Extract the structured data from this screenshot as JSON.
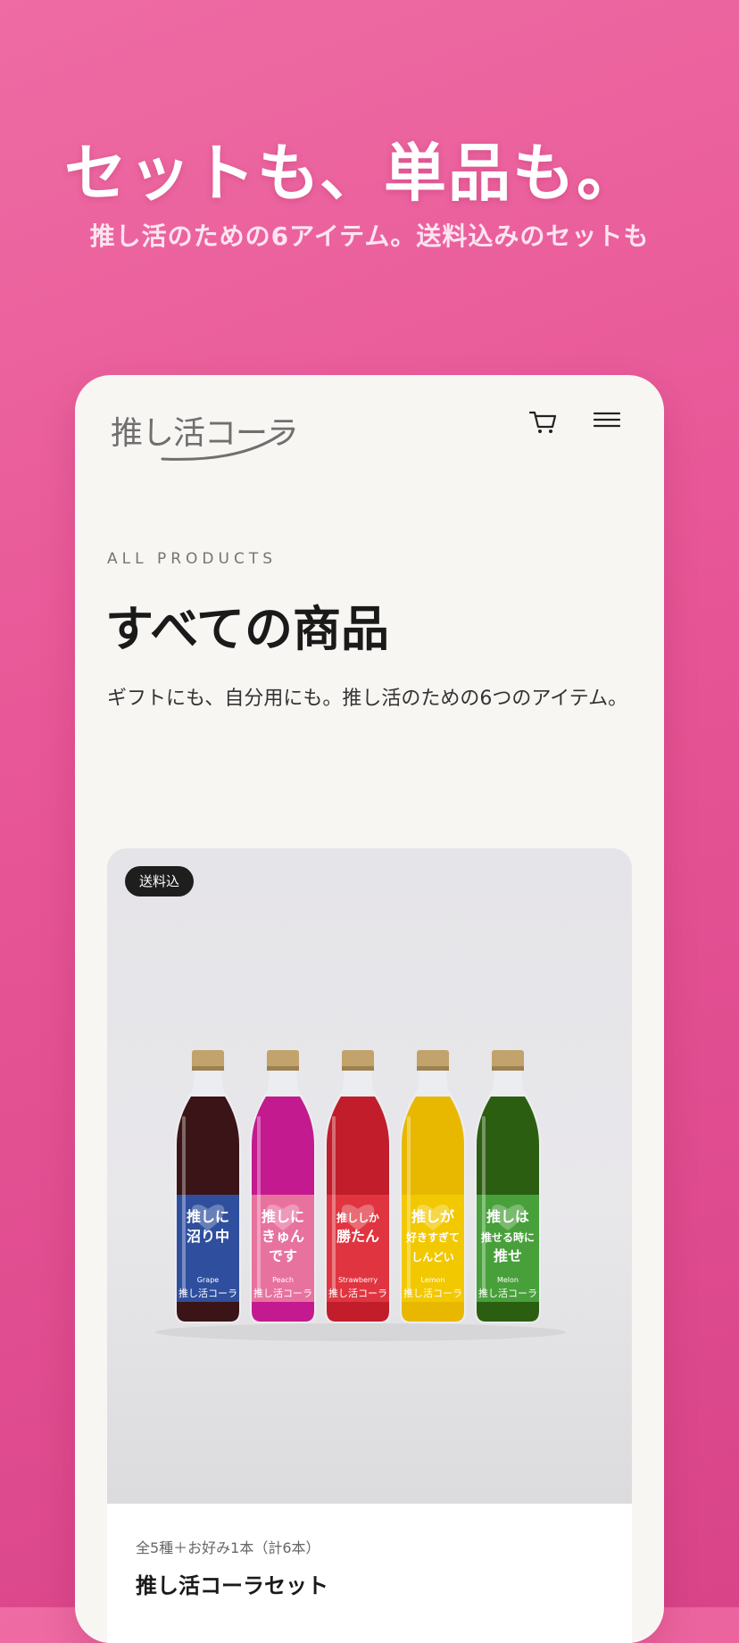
{
  "promo": {
    "headline": "セットも、単品も。",
    "subline": "推し活のための6アイテム。送料込みのセットも"
  },
  "header": {
    "logo_text": "推し活コーラ",
    "cart_icon": "cart-icon",
    "menu_icon": "menu-icon"
  },
  "page": {
    "eyebrow": "ALL PRODUCTS",
    "title": "すべての商品",
    "description": "ギフトにも、自分用にも。推し活のための6つのアイテム。"
  },
  "product": {
    "badge": "送料込",
    "subtitle": "全5種＋お好み1本（計6本）",
    "name": "推し活コーラセット",
    "bottles": [
      {
        "label_lines": [
          "推しに",
          "沼り中"
        ],
        "flavor": "Grape",
        "liquid": "#3a1416",
        "label_color": "#2f4f9e"
      },
      {
        "label_lines": [
          "推しに",
          "きゅん",
          "です"
        ],
        "flavor": "Peach",
        "liquid": "#c41a8f",
        "label_color": "#e8729e"
      },
      {
        "label_lines": [
          "推ししか",
          "勝たん"
        ],
        "flavor": "Strawberry",
        "liquid": "#c11d2b",
        "label_color": "#e03540"
      },
      {
        "label_lines": [
          "推しが",
          "好きすぎて",
          "しんどい"
        ],
        "flavor": "Lemon",
        "liquid": "#e8b800",
        "label_color": "#f2c800"
      },
      {
        "label_lines": [
          "推しは",
          "推せる時に",
          "推せ"
        ],
        "flavor": "Melon",
        "liquid": "#2c5e12",
        "label_color": "#48a03a"
      }
    ]
  },
  "colors": {
    "background": "#e75596",
    "panel": "#f8f6f3",
    "badge": "#1e1e1e"
  }
}
